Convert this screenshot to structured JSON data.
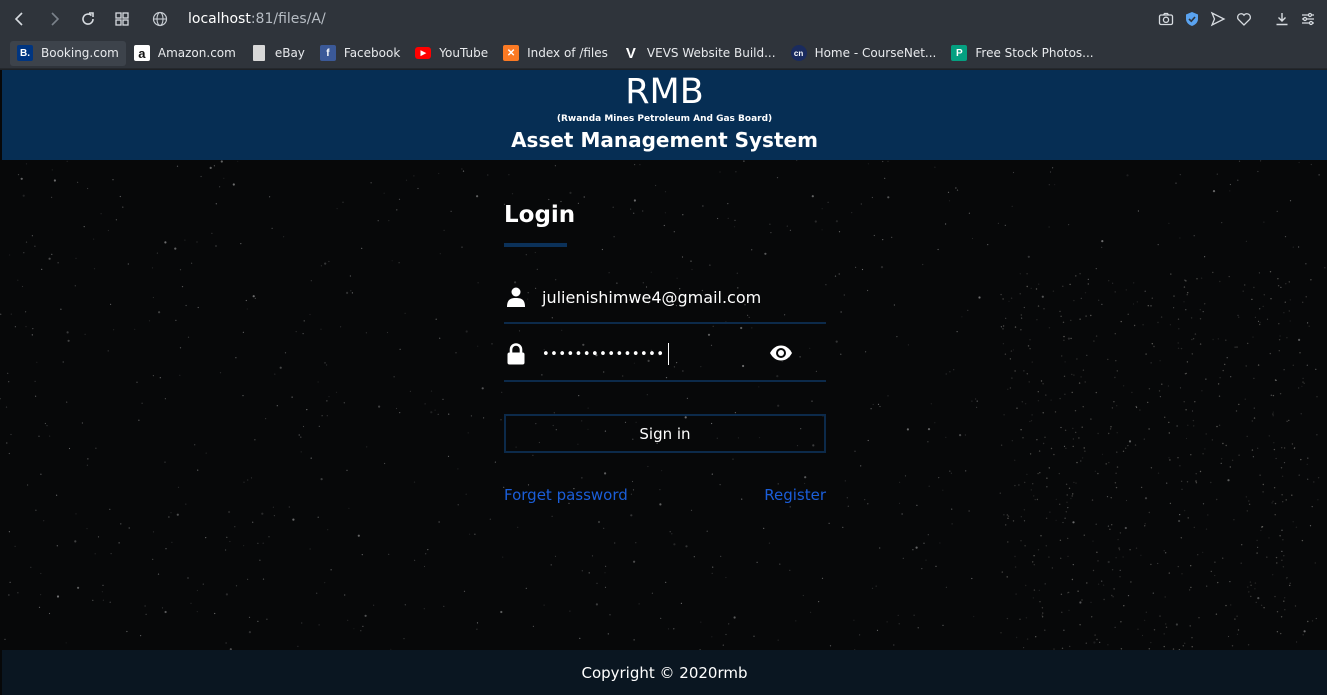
{
  "browser": {
    "url_host": "localhost",
    "url_rest": ":81/files/A/",
    "bookmarks": [
      {
        "label": "Booking.com",
        "icon": "booking-icon",
        "color": "#003580",
        "glyph": "B."
      },
      {
        "label": "Amazon.com",
        "icon": "amazon-icon",
        "color": "#ffffff",
        "glyph": "a"
      },
      {
        "label": "eBay",
        "icon": "page-icon",
        "color": "#d8d8d8",
        "glyph": ""
      },
      {
        "label": "Facebook",
        "icon": "facebook-icon",
        "color": "#3b5998",
        "glyph": "f"
      },
      {
        "label": "YouTube",
        "icon": "youtube-icon",
        "color": "#ff0000",
        "glyph": "▶"
      },
      {
        "label": "Index of /files",
        "icon": "xampp-icon",
        "color": "#fb7a24",
        "glyph": "✕"
      },
      {
        "label": "VEVS Website Build...",
        "icon": "vevs-icon",
        "color": "#2f343b",
        "glyph": "V"
      },
      {
        "label": "Home - CourseNet...",
        "icon": "coursenet-icon",
        "color": "#1a2b5e",
        "glyph": "cn"
      },
      {
        "label": "Free Stock Photos...",
        "icon": "pexels-icon",
        "color": "#05a081",
        "glyph": "P"
      }
    ]
  },
  "header": {
    "brand": "RMB",
    "subtitle": "(Rwanda Mines Petroleum And Gas Board)",
    "system": "Asset Management System"
  },
  "login": {
    "title": "Login",
    "email": "julienishimwe4@gmail.com",
    "password_mask": "•••••••••••••••",
    "sign_in": "Sign in",
    "forget_password": "Forget password",
    "register": "Register"
  },
  "footer": {
    "copyright": "Copyright © 2020rmb"
  },
  "colors": {
    "header_bg": "#062e54",
    "link": "#1b5ed9",
    "footer_bg": "#0a1621"
  }
}
